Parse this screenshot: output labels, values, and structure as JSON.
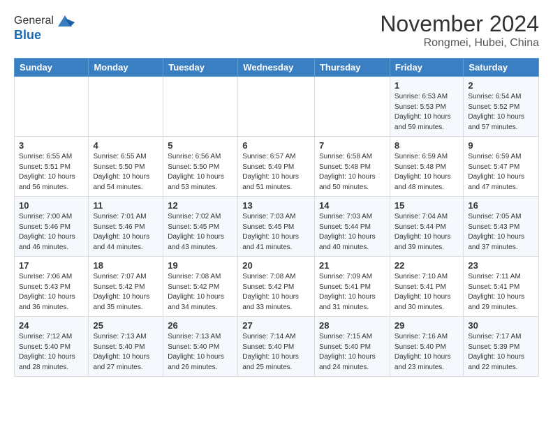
{
  "header": {
    "logo_line1": "General",
    "logo_line2": "Blue",
    "month": "November 2024",
    "location": "Rongmei, Hubei, China"
  },
  "weekdays": [
    "Sunday",
    "Monday",
    "Tuesday",
    "Wednesday",
    "Thursday",
    "Friday",
    "Saturday"
  ],
  "weeks": [
    [
      {
        "day": "",
        "info": ""
      },
      {
        "day": "",
        "info": ""
      },
      {
        "day": "",
        "info": ""
      },
      {
        "day": "",
        "info": ""
      },
      {
        "day": "",
        "info": ""
      },
      {
        "day": "1",
        "info": "Sunrise: 6:53 AM\nSunset: 5:53 PM\nDaylight: 10 hours and 59 minutes."
      },
      {
        "day": "2",
        "info": "Sunrise: 6:54 AM\nSunset: 5:52 PM\nDaylight: 10 hours and 57 minutes."
      }
    ],
    [
      {
        "day": "3",
        "info": "Sunrise: 6:55 AM\nSunset: 5:51 PM\nDaylight: 10 hours and 56 minutes."
      },
      {
        "day": "4",
        "info": "Sunrise: 6:55 AM\nSunset: 5:50 PM\nDaylight: 10 hours and 54 minutes."
      },
      {
        "day": "5",
        "info": "Sunrise: 6:56 AM\nSunset: 5:50 PM\nDaylight: 10 hours and 53 minutes."
      },
      {
        "day": "6",
        "info": "Sunrise: 6:57 AM\nSunset: 5:49 PM\nDaylight: 10 hours and 51 minutes."
      },
      {
        "day": "7",
        "info": "Sunrise: 6:58 AM\nSunset: 5:48 PM\nDaylight: 10 hours and 50 minutes."
      },
      {
        "day": "8",
        "info": "Sunrise: 6:59 AM\nSunset: 5:48 PM\nDaylight: 10 hours and 48 minutes."
      },
      {
        "day": "9",
        "info": "Sunrise: 6:59 AM\nSunset: 5:47 PM\nDaylight: 10 hours and 47 minutes."
      }
    ],
    [
      {
        "day": "10",
        "info": "Sunrise: 7:00 AM\nSunset: 5:46 PM\nDaylight: 10 hours and 46 minutes."
      },
      {
        "day": "11",
        "info": "Sunrise: 7:01 AM\nSunset: 5:46 PM\nDaylight: 10 hours and 44 minutes."
      },
      {
        "day": "12",
        "info": "Sunrise: 7:02 AM\nSunset: 5:45 PM\nDaylight: 10 hours and 43 minutes."
      },
      {
        "day": "13",
        "info": "Sunrise: 7:03 AM\nSunset: 5:45 PM\nDaylight: 10 hours and 41 minutes."
      },
      {
        "day": "14",
        "info": "Sunrise: 7:03 AM\nSunset: 5:44 PM\nDaylight: 10 hours and 40 minutes."
      },
      {
        "day": "15",
        "info": "Sunrise: 7:04 AM\nSunset: 5:44 PM\nDaylight: 10 hours and 39 minutes."
      },
      {
        "day": "16",
        "info": "Sunrise: 7:05 AM\nSunset: 5:43 PM\nDaylight: 10 hours and 37 minutes."
      }
    ],
    [
      {
        "day": "17",
        "info": "Sunrise: 7:06 AM\nSunset: 5:43 PM\nDaylight: 10 hours and 36 minutes."
      },
      {
        "day": "18",
        "info": "Sunrise: 7:07 AM\nSunset: 5:42 PM\nDaylight: 10 hours and 35 minutes."
      },
      {
        "day": "19",
        "info": "Sunrise: 7:08 AM\nSunset: 5:42 PM\nDaylight: 10 hours and 34 minutes."
      },
      {
        "day": "20",
        "info": "Sunrise: 7:08 AM\nSunset: 5:42 PM\nDaylight: 10 hours and 33 minutes."
      },
      {
        "day": "21",
        "info": "Sunrise: 7:09 AM\nSunset: 5:41 PM\nDaylight: 10 hours and 31 minutes."
      },
      {
        "day": "22",
        "info": "Sunrise: 7:10 AM\nSunset: 5:41 PM\nDaylight: 10 hours and 30 minutes."
      },
      {
        "day": "23",
        "info": "Sunrise: 7:11 AM\nSunset: 5:41 PM\nDaylight: 10 hours and 29 minutes."
      }
    ],
    [
      {
        "day": "24",
        "info": "Sunrise: 7:12 AM\nSunset: 5:40 PM\nDaylight: 10 hours and 28 minutes."
      },
      {
        "day": "25",
        "info": "Sunrise: 7:13 AM\nSunset: 5:40 PM\nDaylight: 10 hours and 27 minutes."
      },
      {
        "day": "26",
        "info": "Sunrise: 7:13 AM\nSunset: 5:40 PM\nDaylight: 10 hours and 26 minutes."
      },
      {
        "day": "27",
        "info": "Sunrise: 7:14 AM\nSunset: 5:40 PM\nDaylight: 10 hours and 25 minutes."
      },
      {
        "day": "28",
        "info": "Sunrise: 7:15 AM\nSunset: 5:40 PM\nDaylight: 10 hours and 24 minutes."
      },
      {
        "day": "29",
        "info": "Sunrise: 7:16 AM\nSunset: 5:40 PM\nDaylight: 10 hours and 23 minutes."
      },
      {
        "day": "30",
        "info": "Sunrise: 7:17 AM\nSunset: 5:39 PM\nDaylight: 10 hours and 22 minutes."
      }
    ]
  ]
}
